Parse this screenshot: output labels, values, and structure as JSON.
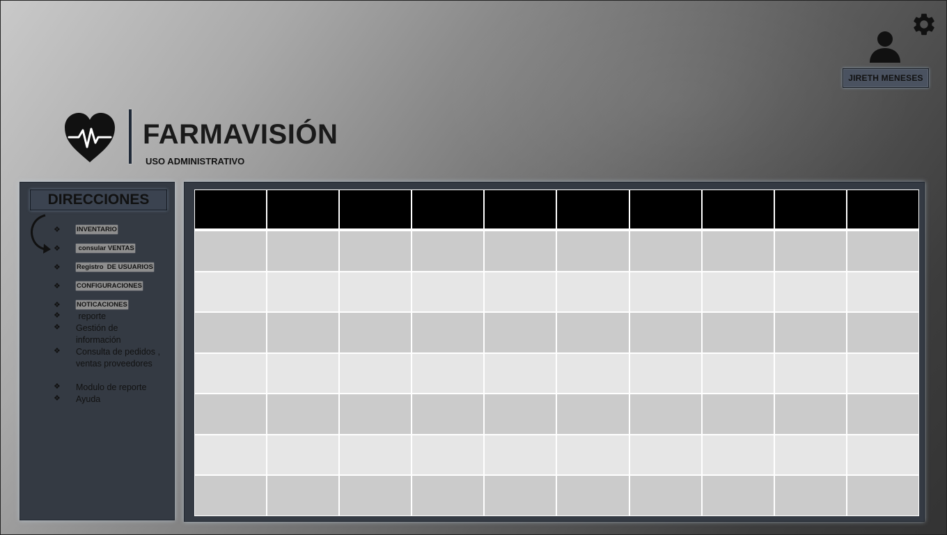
{
  "app": {
    "title": "FARMAVISIÓN",
    "subtitle": "USO ADMINISTRATIVO"
  },
  "user": {
    "name": "JIRETH MENESES",
    "icon": "user-icon",
    "settings_icon": "gear-icon"
  },
  "sidebar": {
    "title": "DIRECCIONES",
    "items": [
      {
        "label": "INVENTARIO",
        "style": "chip"
      },
      {
        "label": " consular VENTAS",
        "style": "chip"
      },
      {
        "label": "Registro  DE USUARIOS",
        "style": "chip"
      },
      {
        "label": "CONFIGURACIONES",
        "style": "chip"
      },
      {
        "label": "NOTICACIONES",
        "style": "chip"
      },
      {
        "label": " reporte",
        "style": "plain"
      },
      {
        "label": "Gestión de información",
        "style": "plain"
      },
      {
        "label": "Consulta de pedidos , ventas proveedores",
        "style": "plain"
      },
      {
        "label": "Modulo de reporte",
        "style": "plain"
      },
      {
        "label": "Ayuda",
        "style": "plain"
      }
    ]
  },
  "table": {
    "columns": 10,
    "header": [
      "",
      "",
      "",
      "",
      "",
      "",
      "",
      "",
      "",
      ""
    ],
    "rows": [
      [
        "",
        "",
        "",
        "",
        "",
        "",
        "",
        "",
        "",
        ""
      ],
      [
        "",
        "",
        "",
        "",
        "",
        "",
        "",
        "",
        "",
        ""
      ],
      [
        "",
        "",
        "",
        "",
        "",
        "",
        "",
        "",
        "",
        ""
      ],
      [
        "",
        "",
        "",
        "",
        "",
        "",
        "",
        "",
        "",
        ""
      ],
      [
        "",
        "",
        "",
        "",
        "",
        "",
        "",
        "",
        "",
        ""
      ],
      [
        "",
        "",
        "",
        "",
        "",
        "",
        "",
        "",
        "",
        ""
      ],
      [
        "",
        "",
        "",
        "",
        "",
        "",
        "",
        "",
        "",
        ""
      ]
    ]
  },
  "colors": {
    "panel": "#343a43",
    "header_cell": "#000000",
    "row_dark": "#cbcbcb",
    "row_light": "#e6e6e6"
  }
}
